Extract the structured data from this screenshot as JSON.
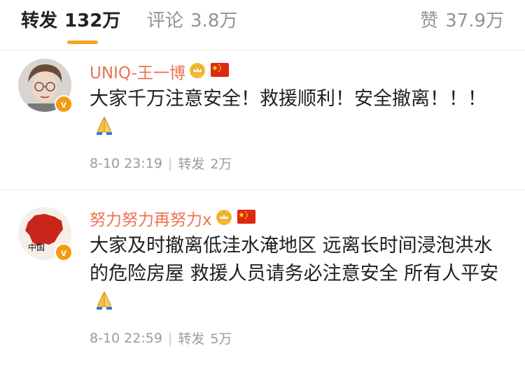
{
  "tabs": [
    {
      "label": "转发",
      "count": "132万"
    },
    {
      "label": "评论",
      "count": "3.8万"
    },
    {
      "label": "赞",
      "count": "37.9万"
    }
  ],
  "comments": [
    {
      "username": "UNIQ-王一博",
      "avatar_icon": "person-avatar",
      "badge_icon": "verified-v-badge",
      "badges": [
        "crown-icon",
        "china-flag-icon"
      ],
      "text": "大家千万注意安全！救援顺利！安全撤离！！！",
      "emoji": "praying-hands-emoji",
      "time": "8-10 23:19",
      "repost_label": "转发",
      "repost_count": "2万"
    },
    {
      "username": "努力努力再努力x",
      "avatar_icon": "china-map-avatar",
      "avatar_text": "中国",
      "badge_icon": "verified-v-badge",
      "badges": [
        "crown-icon",
        "china-flag-icon"
      ],
      "text": "大家及时撤离低洼水淹地区 远离长时间浸泡洪水的危险房屋 救援人员请务必注意安全 所有人平安",
      "emoji": "praying-hands-emoji",
      "time": "8-10 22:59",
      "repost_label": "转发",
      "repost_count": "5万"
    }
  ],
  "colors": {
    "accent": "#f7a51c",
    "username": "#eb7350",
    "muted": "#939393",
    "verified": "#f39c12"
  }
}
